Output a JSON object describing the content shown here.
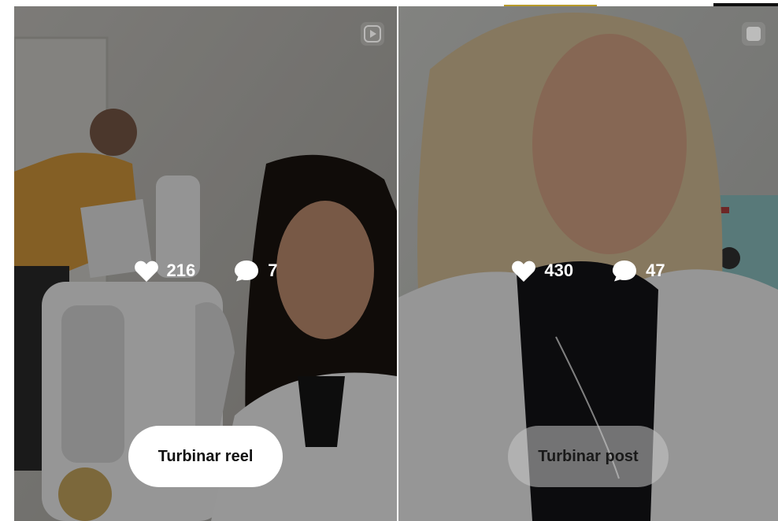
{
  "grid": {
    "posts": [
      {
        "type": "reel",
        "media_icon": "reel-icon",
        "likes": "216",
        "comments": "7",
        "boost_label": "Turbinar reel"
      },
      {
        "type": "post",
        "media_icon": "carousel-icon",
        "likes": "430",
        "comments": "47",
        "boost_label": "Turbinar post"
      }
    ]
  },
  "colors": {
    "overlay": "rgba(0,0,0,0.38)",
    "primary_button_bg": "#ffffff",
    "secondary_button_bg": "rgba(200,200,200,0.55)",
    "stat_text": "#ffffff"
  }
}
